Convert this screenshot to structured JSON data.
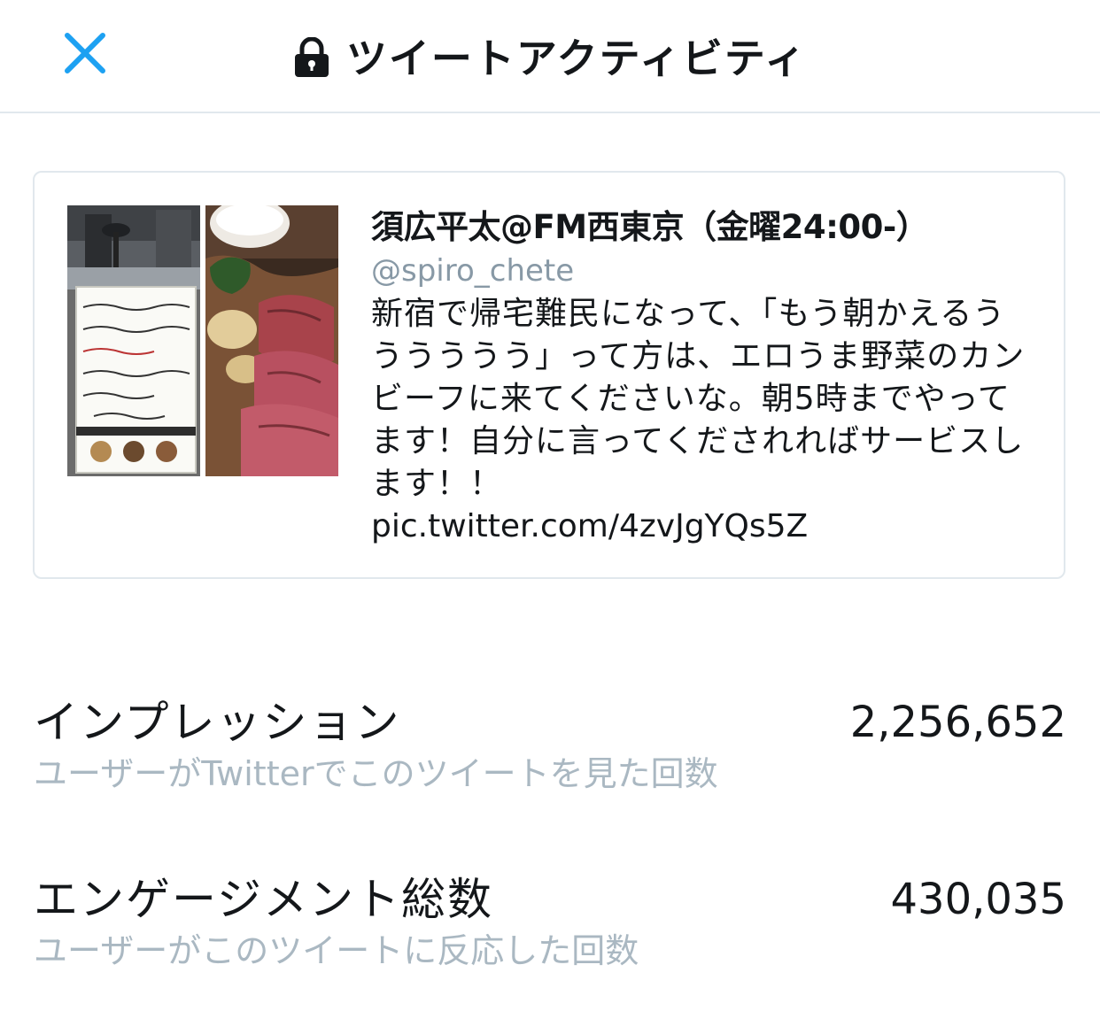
{
  "header": {
    "title": "ツイートアクティビティ",
    "close_icon": "close-icon",
    "lock_icon": "lock-icon"
  },
  "tweet": {
    "author_name": "須広平太@FM西東京（金曜24:00-）",
    "handle": "@spiro_chete",
    "text": "新宿で帰宅難民になって、「もう朝かえるうううううう」って方は、エロうま野菜のカンビーフに来てくださいな。朝5時までやってます！自分に言ってくだされればサービスします！！",
    "link": "pic.twitter.com/4zvJgYQs5Z"
  },
  "metrics": [
    {
      "label": "インプレッション",
      "description": "ユーザーがTwitterでこのツイートを見た回数",
      "value": "2,256,652"
    },
    {
      "label": "エンゲージメント総数",
      "description": "ユーザーがこのツイートに反応した回数",
      "value": "430,035"
    }
  ],
  "colors": {
    "accent": "#1da1f2",
    "text": "#14171a",
    "secondary": "#aab8c2",
    "handle": "#8899a6",
    "border": "#e1e8ed"
  }
}
